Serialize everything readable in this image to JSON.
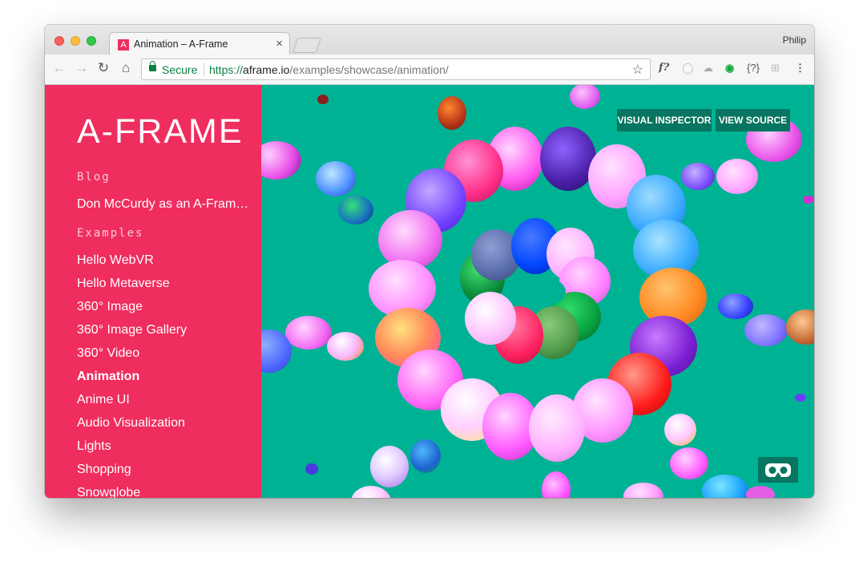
{
  "browser": {
    "tab_title": "Animation – A-Frame",
    "tab_close": "×",
    "profile_name": "Philip",
    "secure_label": "Secure",
    "url": {
      "scheme": "https://",
      "host": "aframe.io",
      "path": "/examples/showcase/animation/"
    },
    "nav_icons": [
      "back-arrow-icon",
      "forward-arrow-icon",
      "reload-icon",
      "home-icon"
    ],
    "extension_labels": [
      "f?",
      "{?}"
    ],
    "colors": {
      "secure_green": "#0b8043"
    }
  },
  "sidebar": {
    "logo": "A-FRAME",
    "blog_heading": "Blog",
    "blog_post": "Don McCurdy as an A-Fram…",
    "examples_heading": "Examples",
    "examples": [
      {
        "label": "Hello WebVR"
      },
      {
        "label": "Hello Metaverse"
      },
      {
        "label": "360° Image"
      },
      {
        "label": "360° Image Gallery"
      },
      {
        "label": "360° Video"
      },
      {
        "label": "Animation",
        "current": true
      },
      {
        "label": "Anime UI"
      },
      {
        "label": "Audio Visualization"
      },
      {
        "label": "Lights"
      },
      {
        "label": "Shopping"
      },
      {
        "label": "Snowglobe"
      }
    ],
    "colors": {
      "background": "#ef2d5e"
    }
  },
  "scene": {
    "buttons": {
      "visual_inspector": "VISUAL INSPECTOR",
      "view_source": "VIEW SOURCE"
    },
    "vr_icon": "vr-headset-icon",
    "colors": {
      "background": "#00b294",
      "button": "#07755f"
    }
  }
}
